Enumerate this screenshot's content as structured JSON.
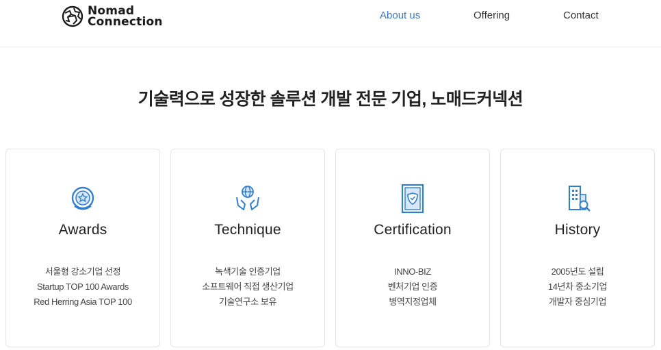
{
  "header": {
    "logo": {
      "line1": "Nomad",
      "line2": "Connection"
    },
    "nav": [
      {
        "label": "About us",
        "active": true
      },
      {
        "label": "Offering",
        "active": false
      },
      {
        "label": "Contact",
        "active": false
      }
    ]
  },
  "main": {
    "headline": "기술력으로 성장한 솔루션 개발 전문 기업, 노매드커넥션",
    "cards": [
      {
        "icon": "award-medal-icon",
        "title": "Awards",
        "lines": [
          "서울형 강소기업 선정",
          "Startup TOP 100 Awards",
          "Red Herring Asia TOP 100"
        ]
      },
      {
        "icon": "globe-hands-icon",
        "title": "Technique",
        "lines": [
          "녹색기술 인증기업",
          "소프트웨어 직접 생산기업",
          "기술연구소 보유"
        ]
      },
      {
        "icon": "certificate-shield-icon",
        "title": "Certification",
        "lines": [
          "INNO-BIZ",
          "벤처기업 인증",
          "병역지정업체"
        ]
      },
      {
        "icon": "building-search-icon",
        "title": "History",
        "lines": [
          "2005년도 설립",
          "14년차 중소기업",
          "개발자 중심기업"
        ]
      }
    ]
  },
  "colors": {
    "accent": "#3a78c9",
    "icon": "#2f7fd1",
    "border": "#e6e6e6"
  }
}
